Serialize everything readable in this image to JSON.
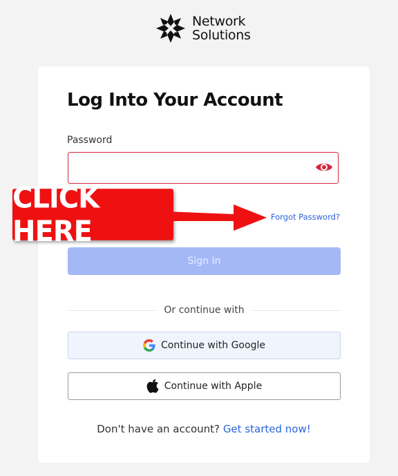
{
  "brand": {
    "line1": "Network",
    "line2": "Solutions"
  },
  "login": {
    "title": "Log Into Your Account",
    "password_label": "Password",
    "password_value": "",
    "forgot_link": "Forgot Password?",
    "signin_label": "Sign In",
    "divider_text": "Or continue with",
    "google_label": "Continue with Google",
    "apple_label": "Continue with Apple",
    "signup_prompt": "Don't have an account?",
    "signup_link": "Get started now!"
  },
  "annotation": {
    "callout_text": "CLICK HERE"
  },
  "colors": {
    "error_border": "#d7263d",
    "link": "#2b63d9",
    "signin_disabled": "#a4b8f6",
    "callout_red": "#ef1111"
  },
  "icons": [
    "network-solutions-logo-icon",
    "eye-icon",
    "google-icon",
    "apple-icon",
    "red-arrow-icon"
  ]
}
